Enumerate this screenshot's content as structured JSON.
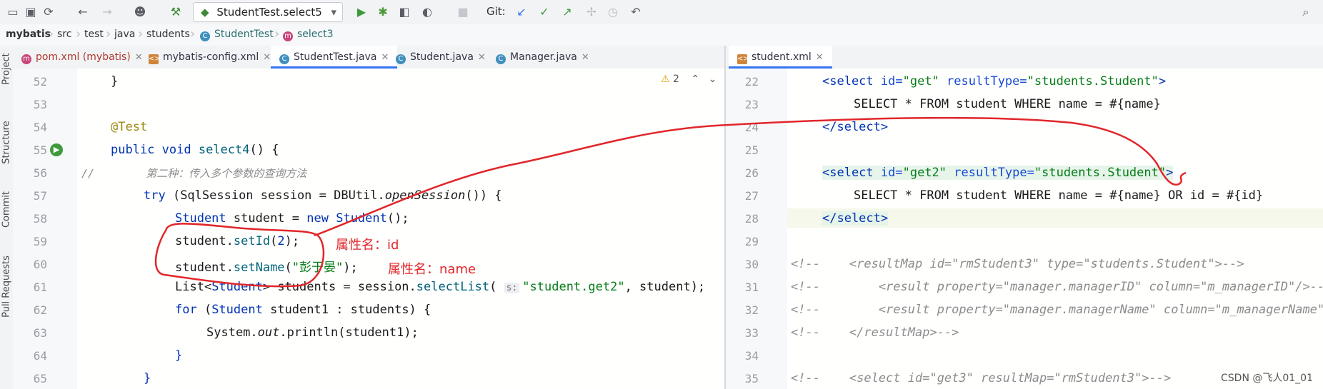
{
  "toolbar": {
    "run_config": "StudentTest.select5",
    "git_label": "Git:",
    "icons": [
      "folder-icon",
      "save-icon",
      "sync-icon",
      "back-icon",
      "forward-icon",
      "user-icon",
      "build-icon",
      "run-icon",
      "debug-icon",
      "coverage-icon",
      "profile-icon",
      "stop-icon",
      "git-update-icon",
      "git-commit-icon",
      "git-push-icon",
      "git-history-icon",
      "rollback-icon",
      "search-icon"
    ]
  },
  "breadcrumb": [
    "mybatis",
    "src",
    "test",
    "java",
    "students",
    "StudentTest",
    "select3"
  ],
  "sidebar": [
    "Project",
    "Structure",
    "Commit",
    "Pull Requests"
  ],
  "left_tabs": [
    {
      "label": "pom.xml (mybatis)",
      "icon": "m"
    },
    {
      "label": "mybatis-config.xml",
      "icon": "xml"
    },
    {
      "label": "StudentTest.java",
      "icon": "C"
    },
    {
      "label": "Student.java",
      "icon": "C"
    },
    {
      "label": "Manager.java",
      "icon": "C"
    }
  ],
  "right_tabs": [
    {
      "label": "student.xml",
      "icon": "xml"
    }
  ],
  "inspection": {
    "count": "2"
  },
  "left_lines": [
    "52",
    "53",
    "54",
    "55",
    "56",
    "57",
    "58",
    "59",
    "60",
    "61",
    "62",
    "63",
    "64",
    "65"
  ],
  "right_lines": [
    "22",
    "23",
    "24",
    "25",
    "26",
    "27",
    "28",
    "29",
    "30",
    "31",
    "32",
    "33",
    "34",
    "35"
  ],
  "annotations": {
    "label1": "属性名：id",
    "label2": "属性名：name"
  },
  "watermark": "CSDN @飞人01_01",
  "colors": {
    "accent": "#3574f0",
    "annotation_red": "#e1262a"
  }
}
